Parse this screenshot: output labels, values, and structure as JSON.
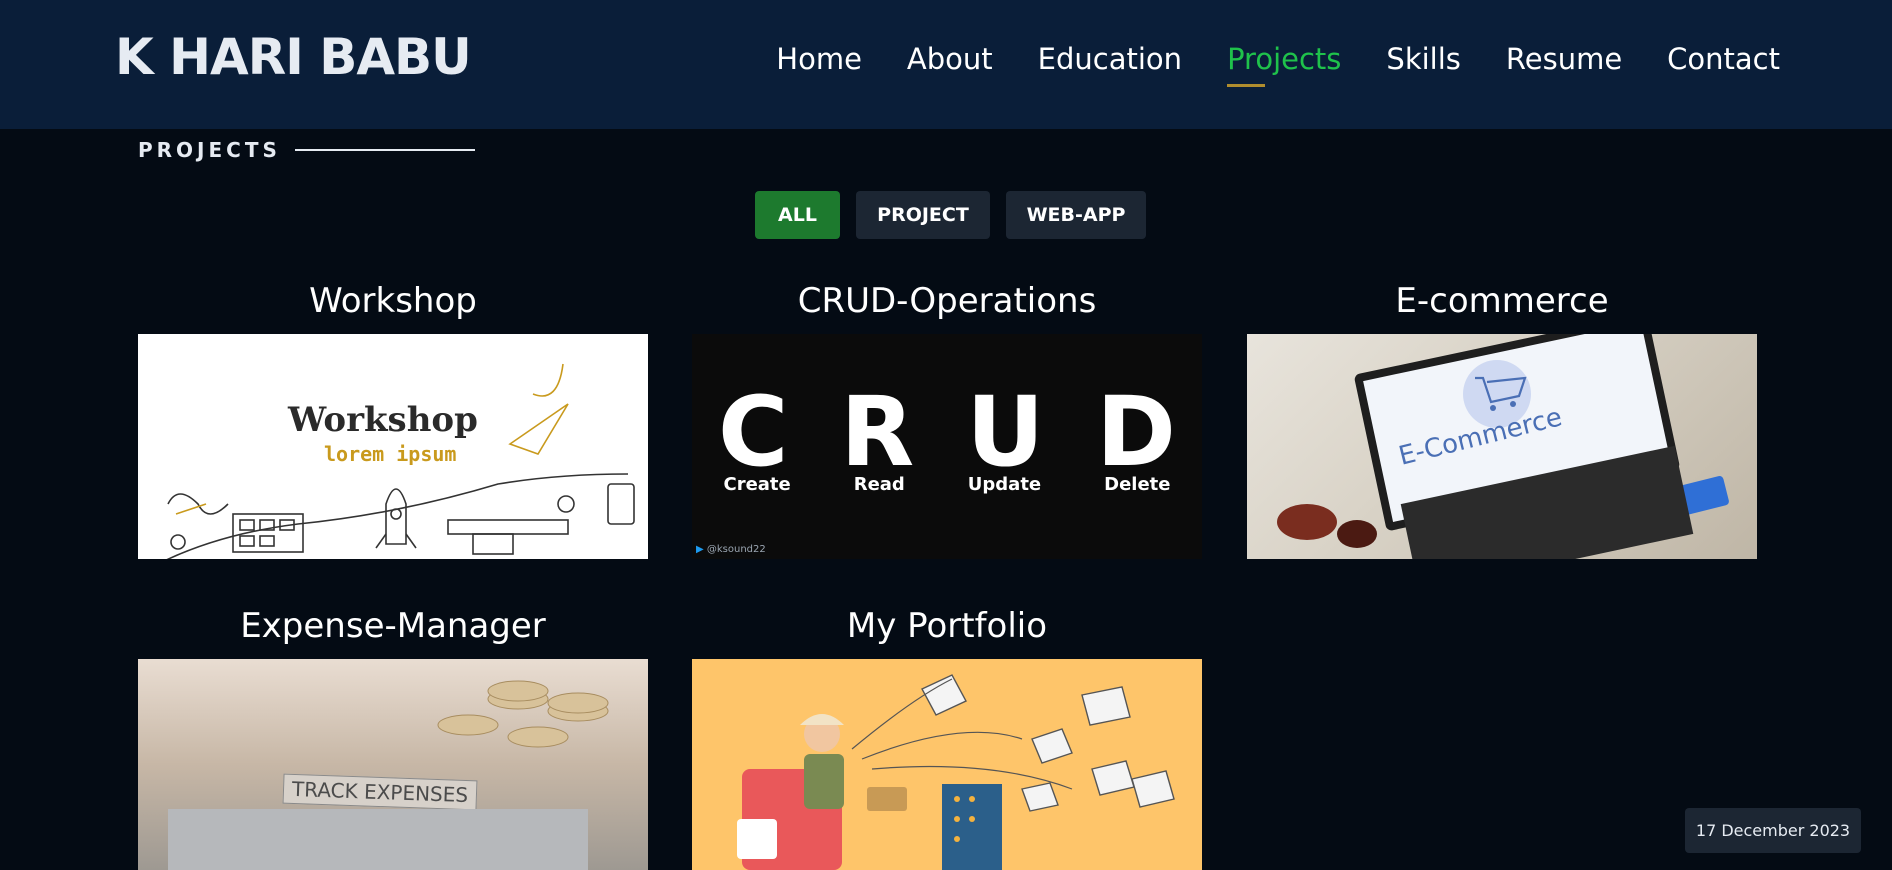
{
  "header": {
    "logo": "K HARI BABU",
    "nav": [
      {
        "label": "Home",
        "active": false
      },
      {
        "label": "About",
        "active": false
      },
      {
        "label": "Education",
        "active": false
      },
      {
        "label": "Projects",
        "active": true
      },
      {
        "label": "Skills",
        "active": false
      },
      {
        "label": "Resume",
        "active": false
      },
      {
        "label": "Contact",
        "active": false
      }
    ]
  },
  "section": {
    "title": "PROJECTS"
  },
  "filters": [
    {
      "label": "ALL",
      "active": true
    },
    {
      "label": "PROJECT",
      "active": false
    },
    {
      "label": "WEB-APP",
      "active": false
    }
  ],
  "projects": [
    {
      "title": "Workshop",
      "image": {
        "headline": "Workshop",
        "subline": "lorem ipsum"
      }
    },
    {
      "title": "CRUD-Operations",
      "image": {
        "letters": [
          "C",
          "R",
          "U",
          "D"
        ],
        "words": [
          "Create",
          "Read",
          "Update",
          "Delete"
        ],
        "handle": "@ksound22"
      }
    },
    {
      "title": "E-commerce",
      "image": {
        "headline": "E-Commerce"
      }
    },
    {
      "title": "Expense-Manager",
      "image": {
        "headline": "TRACK EXPENSES"
      }
    },
    {
      "title": "My Portfolio",
      "image": {}
    }
  ],
  "date_badge": "17 December 2023",
  "colors": {
    "header_bg": "#0a1e39",
    "page_bg": "#040b14",
    "active_nav": "#1fc24b",
    "nav_underline": "#b08d2e",
    "active_filter": "#1d7a2e",
    "filter_bg": "#1c2633"
  }
}
